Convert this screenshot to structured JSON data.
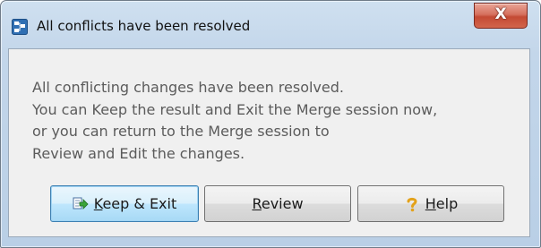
{
  "window": {
    "title": "All conflicts have been resolved",
    "close_label": "X"
  },
  "message": {
    "lines": [
      "All conflicting changes have been resolved.",
      "You can Keep the result and Exit the Merge session now,",
      "or you can return to the Merge session to",
      "Review and Edit the changes."
    ]
  },
  "buttons": {
    "keep_exit": {
      "mnemonic": "K",
      "rest": "eep & Exit",
      "icon": "keep-exit-icon"
    },
    "review": {
      "mnemonic": "R",
      "rest": "eview"
    },
    "help": {
      "mnemonic": "H",
      "rest": "elp",
      "icon": "question-mark-icon"
    }
  },
  "colors": {
    "default_button_border": "#3c7fb1",
    "close_button": "#c44a34",
    "message_text": "#5b5b5b"
  }
}
